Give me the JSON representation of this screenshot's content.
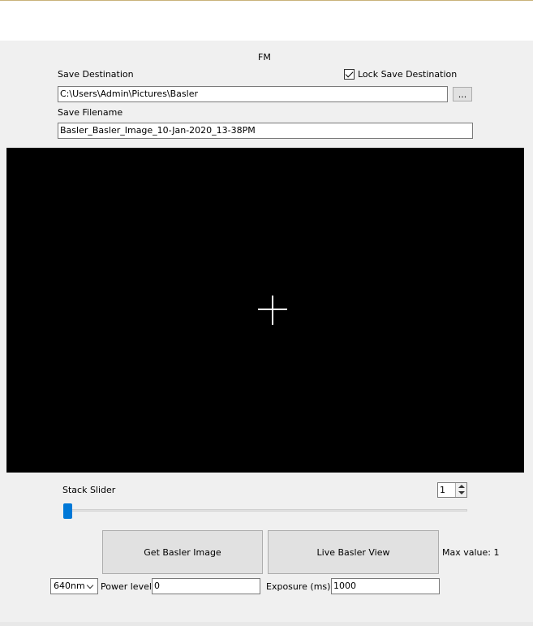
{
  "panel": {
    "title": "FM"
  },
  "save": {
    "destination_label": "Save Destination",
    "lock_label": "Lock Save Destination",
    "lock_checked": true,
    "destination_value": "C:\\Users\\Admin\\Pictures\\Basler",
    "browse_label": "...",
    "filename_label": "Save Filename",
    "filename_value": "Basler_Basler_Image_10-Jan-2020_13-38PM"
  },
  "stack": {
    "label": "Stack Slider",
    "spin_value": "1",
    "slider_fraction": 0.0
  },
  "controls": {
    "get_image_label": "Get Basler Image",
    "live_view_label": "Live Basler View",
    "max_value_label": "Max value: 1",
    "wavelength_selected": "640nm",
    "power_label": "Power level:",
    "power_value": "0",
    "exposure_label": "Exposure (ms):",
    "exposure_value": "1000"
  },
  "icons": {
    "checkbox": "checkbox-checked-icon",
    "crosshair": "crosshair-icon",
    "spin": "spin-arrows-icon",
    "dropdown": "chevron-down-icon"
  }
}
